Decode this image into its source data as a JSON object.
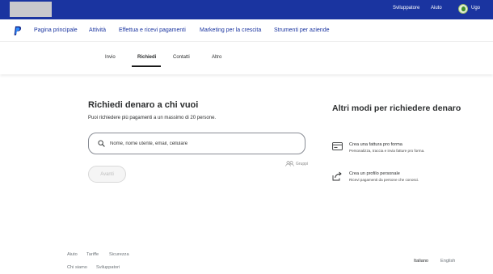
{
  "topbar": {
    "developer_label": "Sviluppatore",
    "help_label": "Aiuto",
    "user_name": "Ugo"
  },
  "mainnav": {
    "items": [
      {
        "label": "Pagina principale"
      },
      {
        "label": "Attività"
      },
      {
        "label": "Effettua e ricevi pagamenti"
      },
      {
        "label": "Marketing per la crescita"
      },
      {
        "label": "Strumenti per aziende"
      }
    ]
  },
  "subtabs": {
    "items": [
      {
        "label": "Invio"
      },
      {
        "label": "Richiedi"
      },
      {
        "label": "Contatti"
      },
      {
        "label": "Altro"
      }
    ],
    "active": "Richiedi"
  },
  "request": {
    "title": "Richiedi denaro a chi vuoi",
    "subtitle": "Puoi richiedere più pagamenti a un massimo di 20 persone.",
    "search_placeholder": "Nome, nome utente, email, cellulare",
    "search_value": "",
    "groups_label": "Gruppi",
    "next_button": "Avanti"
  },
  "other_ways": {
    "title": "Altri modi per richiedere denaro",
    "options": [
      {
        "icon": "invoice-icon",
        "title": "Crea una fattura pro forma",
        "description": "Personalizza, traccia e invia fatture pro forma."
      },
      {
        "icon": "share-icon",
        "title": "Crea un profilo personale",
        "description": "Ricevi pagamenti da persone che conosci."
      }
    ]
  },
  "footer": {
    "links": [
      {
        "label": "Aiuto"
      },
      {
        "label": "Tariffe"
      },
      {
        "label": "Sicurezza"
      },
      {
        "label": "Chi siamo"
      },
      {
        "label": "Sviluppatori"
      }
    ],
    "languages": {
      "current": "Italiano",
      "other": "English"
    }
  },
  "colors": {
    "brand_blue": "#1a34a0",
    "nav_link": "#1a34a0",
    "text": "#2c2e2f",
    "muted": "#6c7378"
  }
}
